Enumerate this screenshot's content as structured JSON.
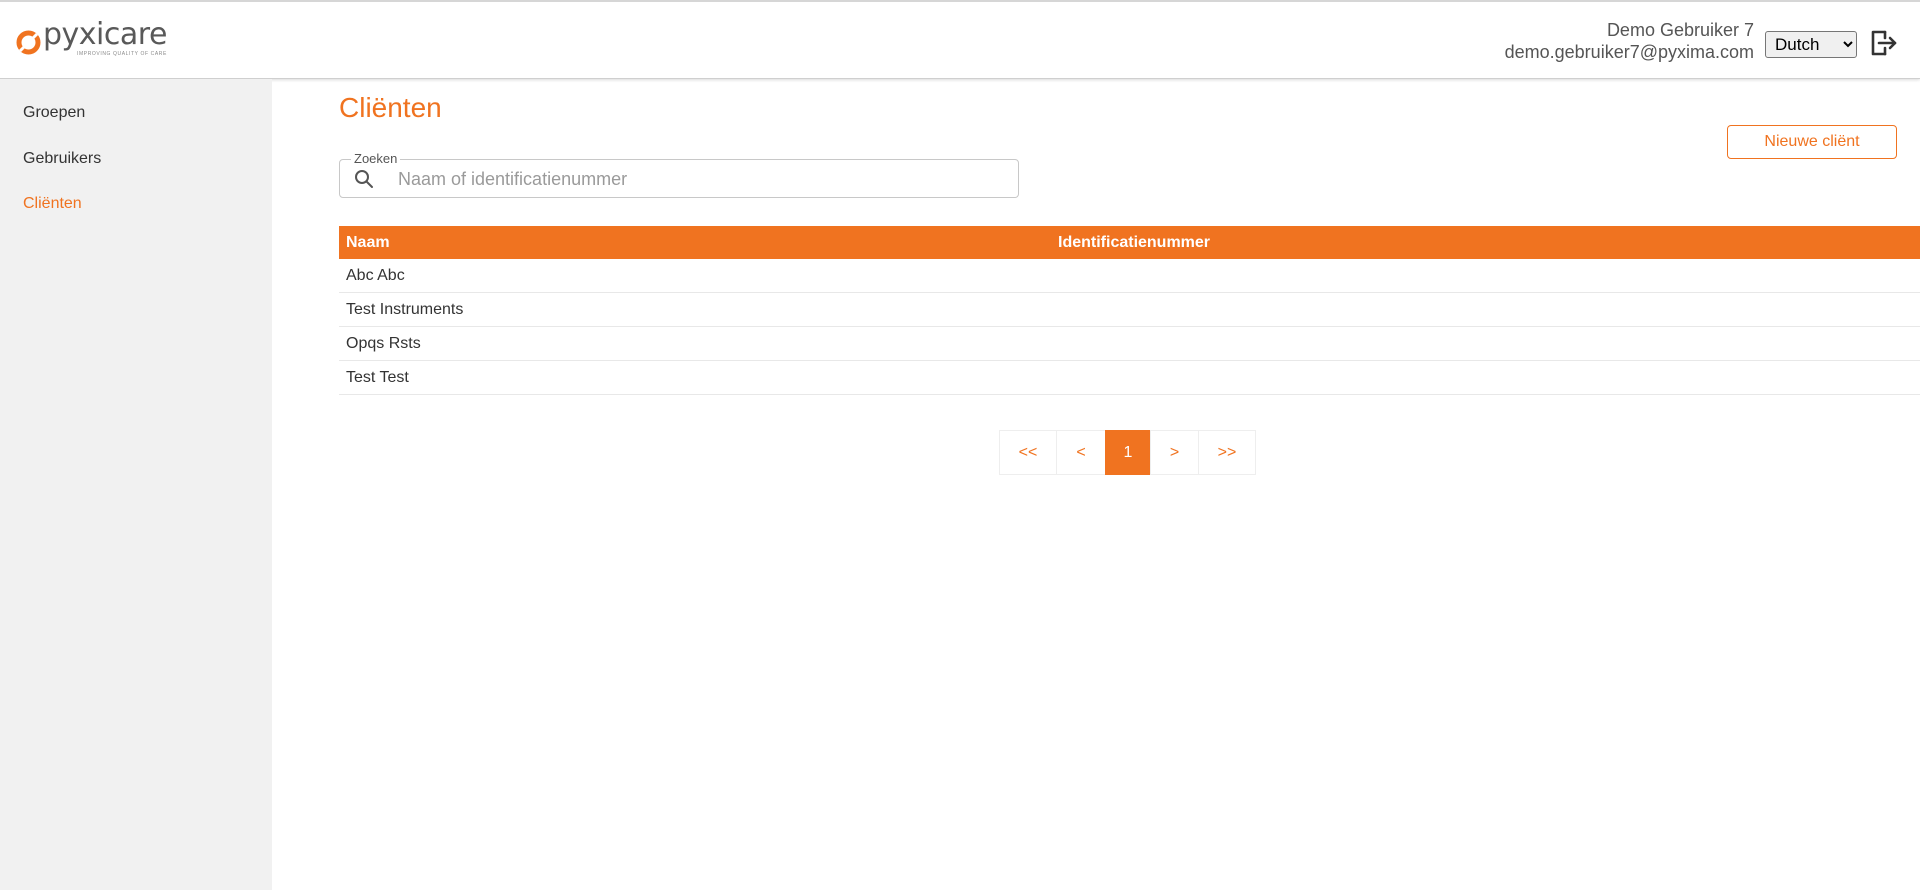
{
  "brand": {
    "name": "pyxicare",
    "tagline": "IMPROVING QUALITY OF CARE",
    "accent_color": "#f07320"
  },
  "header": {
    "user_name": "Demo Gebruiker 7",
    "user_email": "demo.gebruiker7@pyxima.com",
    "language_selected": "Dutch",
    "logout_icon": "logout-icon"
  },
  "sidebar": {
    "items": [
      {
        "label": "Groepen",
        "active": false
      },
      {
        "label": "Gebruikers",
        "active": false
      },
      {
        "label": "Cliënten",
        "active": true
      }
    ]
  },
  "main": {
    "title": "Cliënten",
    "new_button_label": "Nieuwe cliënt",
    "search": {
      "legend": "Zoeken",
      "placeholder": "Naam of identificatienummer",
      "value": "",
      "icon": "search-icon"
    },
    "table": {
      "columns": [
        "Naam",
        "Identificatienummer"
      ],
      "rows": [
        {
          "naam": "Abc Abc",
          "id": ""
        },
        {
          "naam": "Test Instruments",
          "id": ""
        },
        {
          "naam": "Opqs Rsts",
          "id": ""
        },
        {
          "naam": "Test Test",
          "id": ""
        }
      ]
    },
    "pagination": {
      "first": "<<",
      "prev": "<",
      "current": "1",
      "next": ">",
      "last": ">>"
    }
  }
}
